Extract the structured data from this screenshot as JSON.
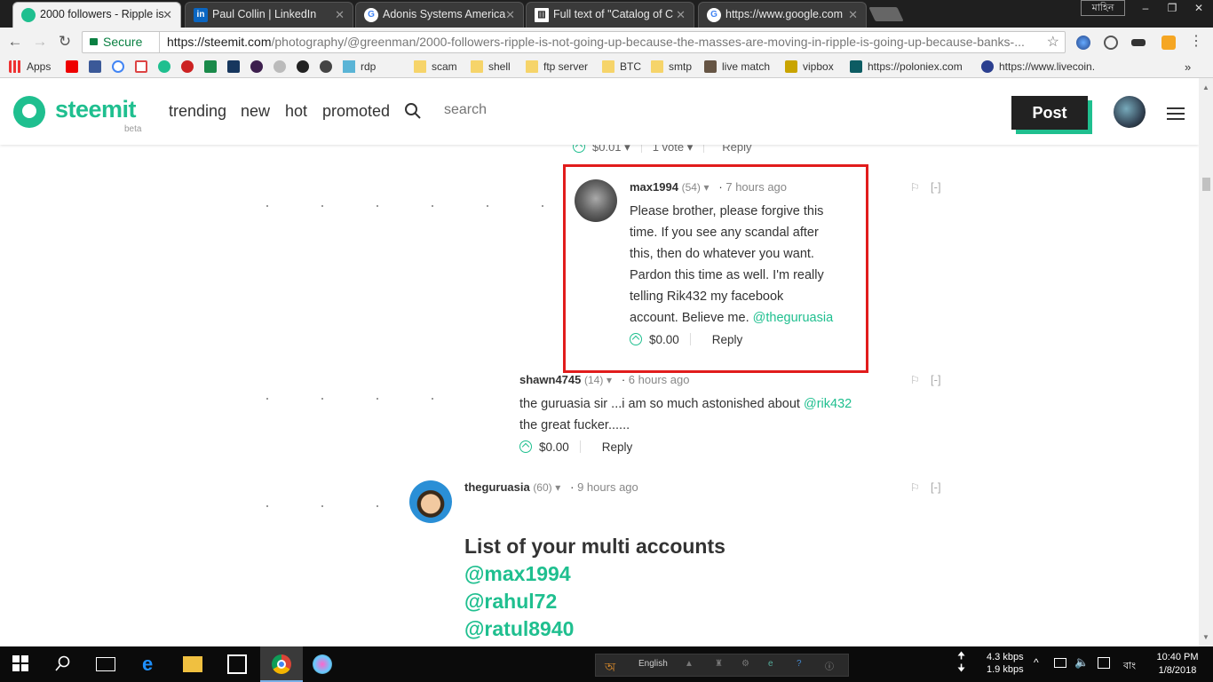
{
  "browser": {
    "tabs": [
      {
        "title": "2000 followers - Ripple is",
        "active": true,
        "icon": "steemit-favicon"
      },
      {
        "title": "Paul Collin | LinkedIn",
        "active": false,
        "icon": "linkedin-favicon"
      },
      {
        "title": "Adonis Systems America",
        "active": false,
        "icon": "google-favicon"
      },
      {
        "title": "Full text of \"Catalog of C",
        "active": false,
        "icon": "archive-favicon"
      },
      {
        "title": "https://www.google.com",
        "active": false,
        "icon": "google-favicon"
      }
    ],
    "window_user": "মাহিন",
    "secure_label": "Secure",
    "url_scheme_host": "https://steemit.com",
    "url_path": "/photography/@greenman/2000-followers-ripple-is-not-going-up-because-the-masses-are-moving-in-ripple-is-going-up-because-banks-...",
    "bookmarks": [
      "Apps",
      "rdp",
      "scam",
      "shell",
      "ftp server",
      "BTC",
      "smtp",
      "live match",
      "vipbox",
      "https://poloniex.com",
      "https://www.livecoin."
    ]
  },
  "steemit": {
    "logo": "steemit",
    "beta": "beta",
    "nav": [
      "trending",
      "new",
      "hot",
      "promoted"
    ],
    "search_placeholder": "search",
    "post_label": "Post"
  },
  "partial_comment": {
    "payout": "$0.01",
    "votes": "1 vote",
    "reply": "Reply"
  },
  "comments": [
    {
      "author": "max1994",
      "rep": "(54)",
      "time": "7 hours ago",
      "lines": [
        "Please brother, please forgive this",
        "time. If you see any scandal after",
        "this, then do whatever you want.",
        "Pardon this time as well. I'm really",
        "telling Rik432 my facebook",
        "account. Believe me. "
      ],
      "mention": "@theguruasia",
      "payout": "$0.00",
      "reply": "Reply",
      "collapse": "[-]"
    },
    {
      "author": "shawn4745",
      "rep": "(14)",
      "time": "6 hours ago",
      "line1": "the guruasia sir ...i am so much astonished about ",
      "mention": "@rik432",
      "line2": "the great fucker......",
      "payout": "$0.00",
      "reply": "Reply",
      "collapse": "[-]"
    },
    {
      "author": "theguruasia",
      "rep": "(60)",
      "time": "9 hours ago",
      "heading": "List of your multi accounts",
      "accounts": [
        "@max1994",
        "@rahul72",
        "@ratul8940"
      ],
      "collapse": "[-]"
    }
  ],
  "taskbar": {
    "language": "English",
    "upload": "4.3 kbps",
    "download": "1.9 kbps",
    "input_lang": "বাং",
    "time": "10:40 PM",
    "date": "1/8/2018"
  },
  "colors": {
    "accent": "#1fbf8f",
    "highlight": "#e11c1c"
  }
}
